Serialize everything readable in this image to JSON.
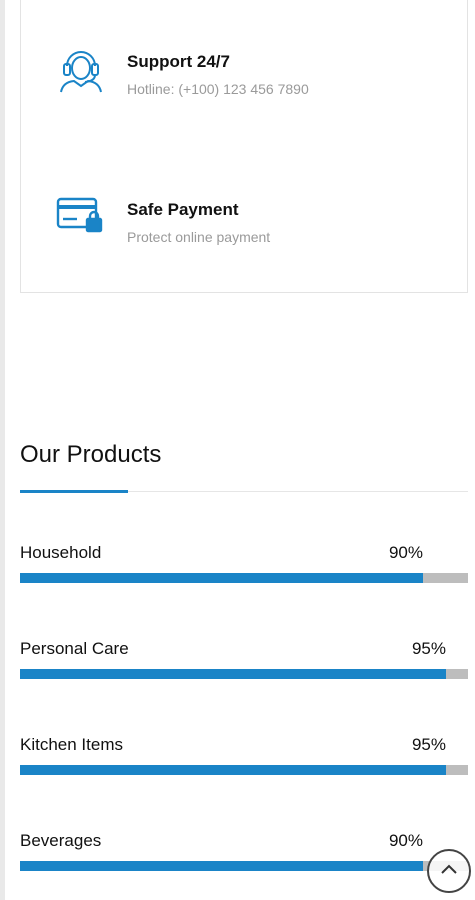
{
  "features": [
    {
      "icon": "headset-icon",
      "title": "Support 24/7",
      "desc": "Hotline: (+100) 123 456 7890"
    },
    {
      "icon": "credit-card-lock-icon",
      "title": "Safe Payment",
      "desc": "Protect online payment"
    }
  ],
  "products": {
    "heading": "Our Products",
    "items": [
      {
        "name": "Household",
        "percent": "90%",
        "value": 0.9
      },
      {
        "name": "Personal Care",
        "percent": "95%",
        "value": 0.95
      },
      {
        "name": "Kitchen Items",
        "percent": "95%",
        "value": 0.95
      },
      {
        "name": "Beverages",
        "percent": "90%",
        "value": 0.9
      }
    ]
  },
  "colors": {
    "accent": "#1a84c7",
    "track": "#bdbdbd",
    "muted": "#9a9a9a"
  },
  "scroll_top_icon": "chevron-up-icon"
}
